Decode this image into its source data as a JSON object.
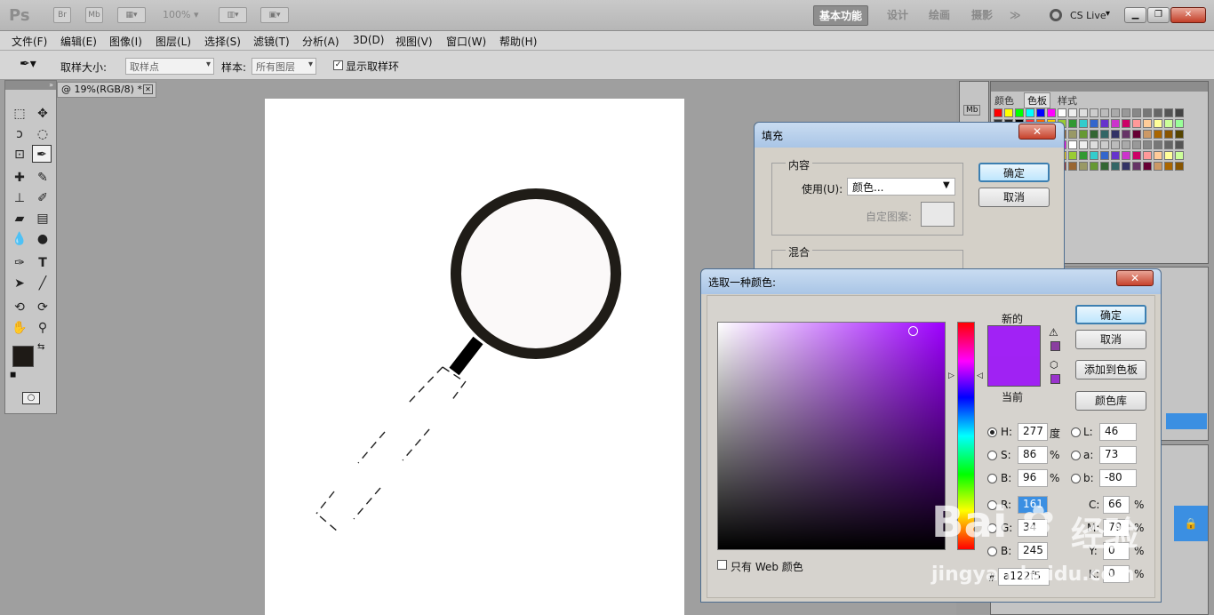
{
  "app": {
    "logo": "Ps",
    "br": "Br",
    "mb": "Mb",
    "zoom": "100%",
    "cslive": "CS Live"
  },
  "workspaces": [
    "基本功能",
    "设计",
    "绘画",
    "摄影",
    "≫"
  ],
  "menu": [
    "文件(F)",
    "编辑(E)",
    "图像(I)",
    "图层(L)",
    "选择(S)",
    "滤镜(T)",
    "分析(A)",
    "3D(D)",
    "视图(V)",
    "窗口(W)",
    "帮助(H)"
  ],
  "options": {
    "sample_size_label": "取样大小:",
    "sample_size_value": "取样点",
    "sample_label": "样本:",
    "sample_value": "所有图层",
    "show_ring": "显示取样环"
  },
  "document": {
    "tab_title": "@ 19%(RGB/8) *"
  },
  "panels": {
    "tabs": [
      "颜色",
      "色板",
      "样式"
    ]
  },
  "fill_dialog": {
    "title": "填充",
    "content_group": "内容",
    "use_label": "使用(U):",
    "use_value": "颜色...",
    "custom_pattern": "自定图案:",
    "blend_group": "混合",
    "ok": "确定",
    "cancel": "取消"
  },
  "picker": {
    "title": "选取一种颜色:",
    "new_label": "新的",
    "current_label": "当前",
    "ok": "确定",
    "cancel": "取消",
    "add_swatch": "添加到色板",
    "library": "颜色库",
    "new_color": "#a122f5",
    "current_color": "#a022f3",
    "gamut_color": "#8a3fa0",
    "web_color": "#9933cc",
    "h_label": "H:",
    "h_value": "277",
    "h_unit": "度",
    "s_label": "S:",
    "s_value": "86",
    "s_unit": "%",
    "b_label": "B:",
    "b_value": "96",
    "b_unit": "%",
    "r_label": "R:",
    "r_value": "161",
    "g_label": "G:",
    "g_value": "34",
    "bb_label": "B:",
    "bb_value": "245",
    "l_label": "L:",
    "l_value": "46",
    "a_label": "a:",
    "a_value": "73",
    "lab_b_label": "b:",
    "lab_b_value": "-80",
    "c_label": "C:",
    "c_value": "66",
    "c_unit": "%",
    "m_label": "M:",
    "m_value": "79",
    "m_unit": "%",
    "y_label": "Y:",
    "y_value": "0",
    "y_unit": "%",
    "k_label": "K:",
    "k_value": "0",
    "k_unit": "%",
    "hex_label": "#",
    "hex_value": "a122f5",
    "web_only": "只有 Web 颜色"
  },
  "watermark": {
    "brand": "Bai",
    "brand2": "经验",
    "url": "jingyan.baidu.com"
  }
}
